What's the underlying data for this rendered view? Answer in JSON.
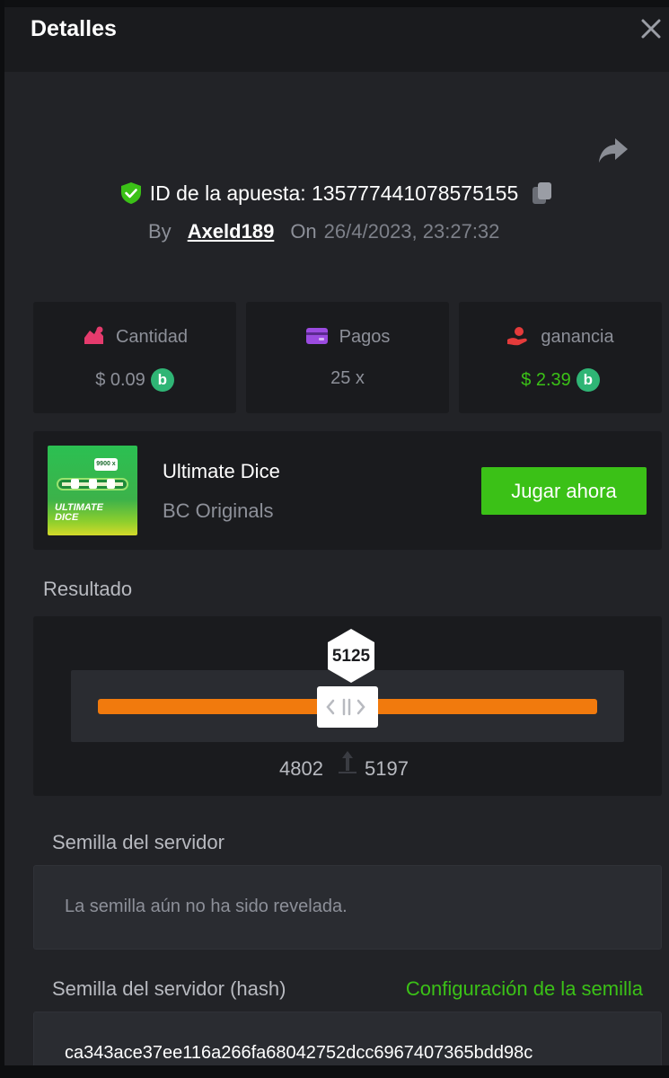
{
  "dialog": {
    "title": "Detalles",
    "close_icon": "close-icon",
    "share_icon": "share-icon"
  },
  "bet": {
    "id_label": "ID de la apuesta: 135777441078575155",
    "by_label": "By",
    "username": "Axeld189",
    "on_label": "On",
    "datetime": "26/4/2023, 23:27:32",
    "verified_icon": "shield-check-icon",
    "copy_icon": "copy-icon"
  },
  "stats": [
    {
      "label": "Cantidad",
      "value": "$ 0.09",
      "icon": "coins-icon",
      "coin": "b",
      "value_color": "#8d9099"
    },
    {
      "label": "Pagos",
      "value": "25 x",
      "icon": "card-icon",
      "value_color": "#8d9099"
    },
    {
      "label": "ganancia",
      "value": "$ 2.39",
      "icon": "profit-hand-icon",
      "coin": "b",
      "value_color": "#3bc117"
    }
  ],
  "game": {
    "name": "Ultimate Dice",
    "provider": "BC Originals",
    "play_label": "Jugar ahora",
    "thumb_tag": "9900 x",
    "thumb_title_1": "ULTIMATE",
    "thumb_title_2": "DICE"
  },
  "result": {
    "label": "Resultado",
    "value": "5125",
    "range_low": "4802",
    "range_high": "5197"
  },
  "server_seed": {
    "label": "Semilla del servidor",
    "text": "La semilla aún no ha sido revelada."
  },
  "server_seed_hash": {
    "label": "Semilla del servidor (hash)",
    "config_link": "Configuración de la semilla",
    "value": "ca343ace37ee116a266fa68042752dcc6967407365bdd98c"
  },
  "colors": {
    "accent_green": "#3bc117",
    "slider_orange": "#f17a0d",
    "panel_bg": "#222327",
    "card_bg": "#1a1b1e"
  }
}
